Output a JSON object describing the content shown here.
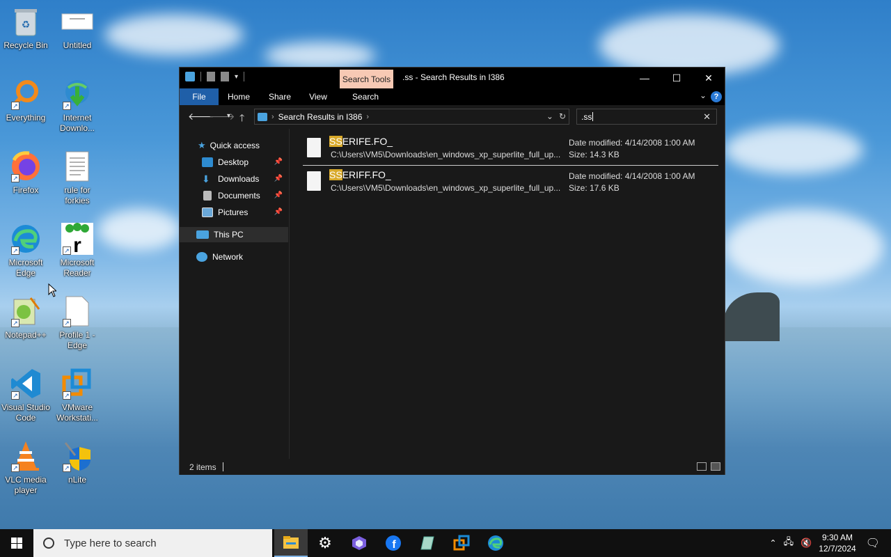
{
  "desktop": {
    "icons": [
      {
        "label": "Recycle Bin"
      },
      {
        "label": "Untitled"
      },
      {
        "label": "Everything"
      },
      {
        "label": "Internet Downlo..."
      },
      {
        "label": "Firefox"
      },
      {
        "label": "rule for forkies"
      },
      {
        "label": "Microsoft Edge"
      },
      {
        "label": "Microsoft Reader"
      },
      {
        "label": "Notepad++"
      },
      {
        "label": "Profile 1 - Edge"
      },
      {
        "label": "Visual Studio Code"
      },
      {
        "label": "VMware Workstati..."
      },
      {
        "label": "VLC media player"
      },
      {
        "label": "nLite"
      }
    ]
  },
  "explorer": {
    "contextual_tab": "Search Tools",
    "title": ".ss - Search Results in I386",
    "controls": {
      "minimize": "—",
      "maximize": "☐",
      "close": "✕"
    },
    "ribbon_tabs": [
      "File",
      "Home",
      "Share",
      "View",
      "Search"
    ],
    "help": "?",
    "address": {
      "crumb": "Search Results in I386"
    },
    "search": {
      "value": ".ss"
    },
    "nav": [
      {
        "label": "Quick access"
      },
      {
        "label": "Desktop"
      },
      {
        "label": "Downloads"
      },
      {
        "label": "Documents"
      },
      {
        "label": "Pictures"
      },
      {
        "label": "This PC"
      },
      {
        "label": "Network"
      }
    ],
    "files": [
      {
        "highlight": "SS",
        "name_rest": "ERIFE.FO_",
        "path": "C:\\Users\\VM5\\Downloads\\en_windows_xp_superlite_full_up...",
        "date": "Date modified: 4/14/2008 1:00 AM",
        "size": "Size: 14.3 KB"
      },
      {
        "highlight": "SS",
        "name_rest": "ERIFF.FO_",
        "path": "C:\\Users\\VM5\\Downloads\\en_windows_xp_superlite_full_up...",
        "date": "Date modified: 4/14/2008 1:00 AM",
        "size": "Size: 17.6 KB"
      }
    ],
    "status": {
      "count": "2 items"
    }
  },
  "taskbar": {
    "search_placeholder": "Type here to search",
    "time": "9:30 AM",
    "date": "12/7/2024"
  },
  "colors": {
    "accent": "#1f5fa8",
    "search_tools_bg": "#f7c9b4",
    "highlight": "#d8a92a"
  }
}
